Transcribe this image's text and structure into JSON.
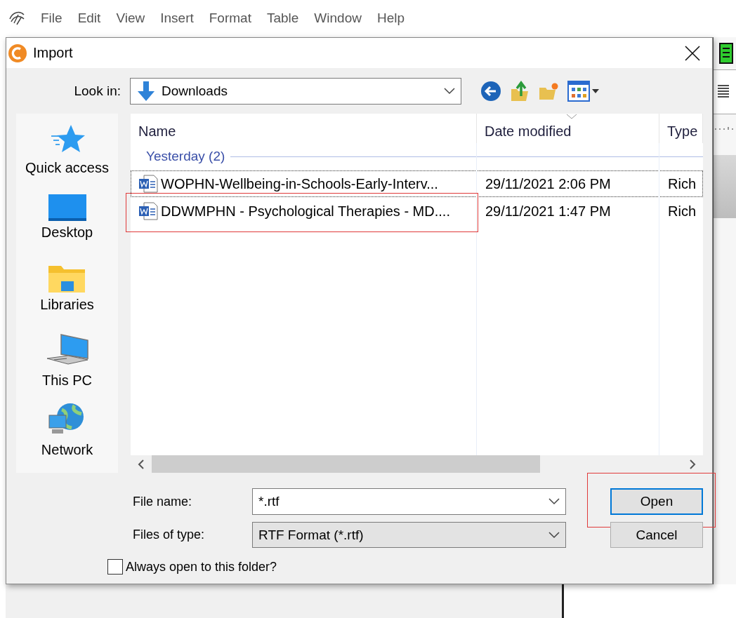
{
  "menu_bar": {
    "items": [
      "File",
      "Edit",
      "View",
      "Insert",
      "Format",
      "Table",
      "Window",
      "Help"
    ]
  },
  "dialog": {
    "title": "Import",
    "look_in": {
      "label": "Look in:",
      "value": "Downloads"
    },
    "places": [
      {
        "label": "Quick access",
        "kind": "quick"
      },
      {
        "label": "Desktop",
        "kind": "desktop"
      },
      {
        "label": "Libraries",
        "kind": "libraries"
      },
      {
        "label": "This PC",
        "kind": "pc"
      },
      {
        "label": "Network",
        "kind": "network"
      }
    ],
    "file_list": {
      "columns": [
        "Name",
        "Date modified",
        "Type"
      ],
      "group": "Yesterday (2)",
      "rows": [
        {
          "name": "WOPHN-Wellbeing-in-Schools-Early-Interv...",
          "date": "29/11/2021 2:06 PM",
          "type": "Rich",
          "focused": true,
          "highlighted": false
        },
        {
          "name": "DDWMPHN - Psychological Therapies - MD....",
          "date": "29/11/2021 1:47 PM",
          "type": "Rich",
          "focused": false,
          "highlighted": true
        }
      ]
    },
    "file_name": {
      "label": "File name:",
      "value": "*.rtf"
    },
    "file_type": {
      "label": "Files of type:",
      "value": "RTF Format (*.rtf)"
    },
    "buttons": [
      {
        "label": "Open",
        "default": true,
        "highlighted": true
      },
      {
        "label": "Cancel",
        "default": false,
        "highlighted": false
      }
    ],
    "always_open": {
      "label": "Always open to this folder?",
      "checked": false
    }
  }
}
